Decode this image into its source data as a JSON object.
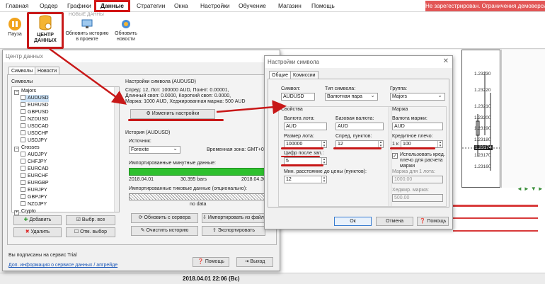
{
  "menu": {
    "items": [
      "Главная",
      "Ордер",
      "Графики",
      "Данные",
      "Стратегии",
      "Окна",
      "Настройки",
      "Обучение",
      "Магазин",
      "Помощь"
    ],
    "warning": "Не зарегестрирован. Ограничения демоверсии"
  },
  "ribbon": {
    "pause": "Пауза",
    "data_center": "ЦЕНТР ДАННЫХ",
    "group": "НОВЫЕ ДАННЫ",
    "update_history": "Обновить историю в проекте",
    "update_news": "Обновить новости"
  },
  "chart": {
    "prices": [
      "1.23230",
      "1.23220",
      "1.23210",
      "1.23200",
      "1.23190",
      "1.23180",
      "1.23174",
      "1.23170",
      "1.23160"
    ]
  },
  "status": {
    "datetime": "2018.04.01 22:06 (Вс)"
  },
  "data_center": {
    "title": "Центр данных",
    "tabs": [
      "Символы",
      "Новости"
    ],
    "symbols_group": "Символы",
    "tree": {
      "majors": "Majors",
      "majors_items": [
        "AUDUSD",
        "EURUSD",
        "GBPUSD",
        "NZDUSD",
        "USDCAD",
        "USDCHF",
        "USDJPY"
      ],
      "crosses": "Crosses",
      "crosses_items": [
        "AUDJPY",
        "CHFJPY",
        "EURCAD",
        "EURCHF",
        "EURGBP",
        "EURJPY",
        "GBPJPY",
        "NZDJPY"
      ],
      "crypto": "Crypto"
    },
    "buttons": {
      "add": "Добавить",
      "select_all": "Выбр. все",
      "delete": "Удалить",
      "deselect": "Отм. выбор"
    },
    "settings_group": "Настройки символа (AUDUSD)",
    "settings_lines": [
      "Спред: 12, Лот: 100000 AUD, Поинт: 0.00001,",
      "Длинный своп: 0.0000, Короткий своп: 0.0000,",
      "Маржа: 1000 AUD, Хеджированная маржа: 500 AUD"
    ],
    "change_settings": "Изменить настройки",
    "history_group": "История (AUDUSD)",
    "source_label": "Источник:",
    "source_value": "Forexite",
    "timezone": "Временная зона: GMT+0",
    "minute_data_label": "Импортированные минутные данные:",
    "minute_from": "2018.04.01",
    "minute_bars": "30.395 bars",
    "minute_to": "2018.04.30",
    "tick_data_label": "Импортированные тиковые данные (опционально):",
    "tick_status": "no data",
    "update_from_server": "Обновить с сервера",
    "import_file": "Импортировать из файла",
    "clear_history": "Очистить историю",
    "export": "Экспортировать",
    "trial": "Вы подписаны на сервис Trial",
    "more_info": "Доп. информация о сервисе данных / апгрейде",
    "help": "Помощь",
    "exit": "Выход"
  },
  "symbol_settings": {
    "title": "Настройки символа",
    "tabs": [
      "Общие",
      "Комиссии"
    ],
    "symbol_label": "Символ:",
    "symbol_value": "AUDUSD",
    "type_label": "Тип символа:",
    "type_value": "Валютная пара",
    "group_label": "Группа:",
    "group_value": "Majors",
    "props_label": "Свойства",
    "lot_currency_label": "Валюта лота:",
    "lot_currency_value": "AUD",
    "base_currency_label": "Базовая валюта:",
    "base_currency_value": "AUD",
    "lot_size_label": "Размер лота:",
    "lot_size_value": "100000",
    "spread_label": "Спред, пунктов:",
    "spread_value": "12",
    "digits_label": "Цифр после зап.:",
    "digits_value": "5",
    "min_dist_label": "Мин. расстояние до цены (пунктов):",
    "min_dist_value": "12",
    "margin_label": "Маржа",
    "margin_currency_label": "Валюта маржи:",
    "margin_currency_value": "AUD",
    "leverage_label": "Кредитное плечо:",
    "leverage_prefix": "1 к",
    "leverage_value": "100",
    "use_leverage_label": "Использовать кред. плечо для расчета маржи",
    "margin_lot_label": "Маржа для 1 лота:",
    "margin_lot_value": "1000.00",
    "hedge_label": "Хеджир. маржа:",
    "hedge_value": "500.00",
    "ok": "Ок",
    "cancel": "Отмена",
    "help": "Помощь"
  }
}
